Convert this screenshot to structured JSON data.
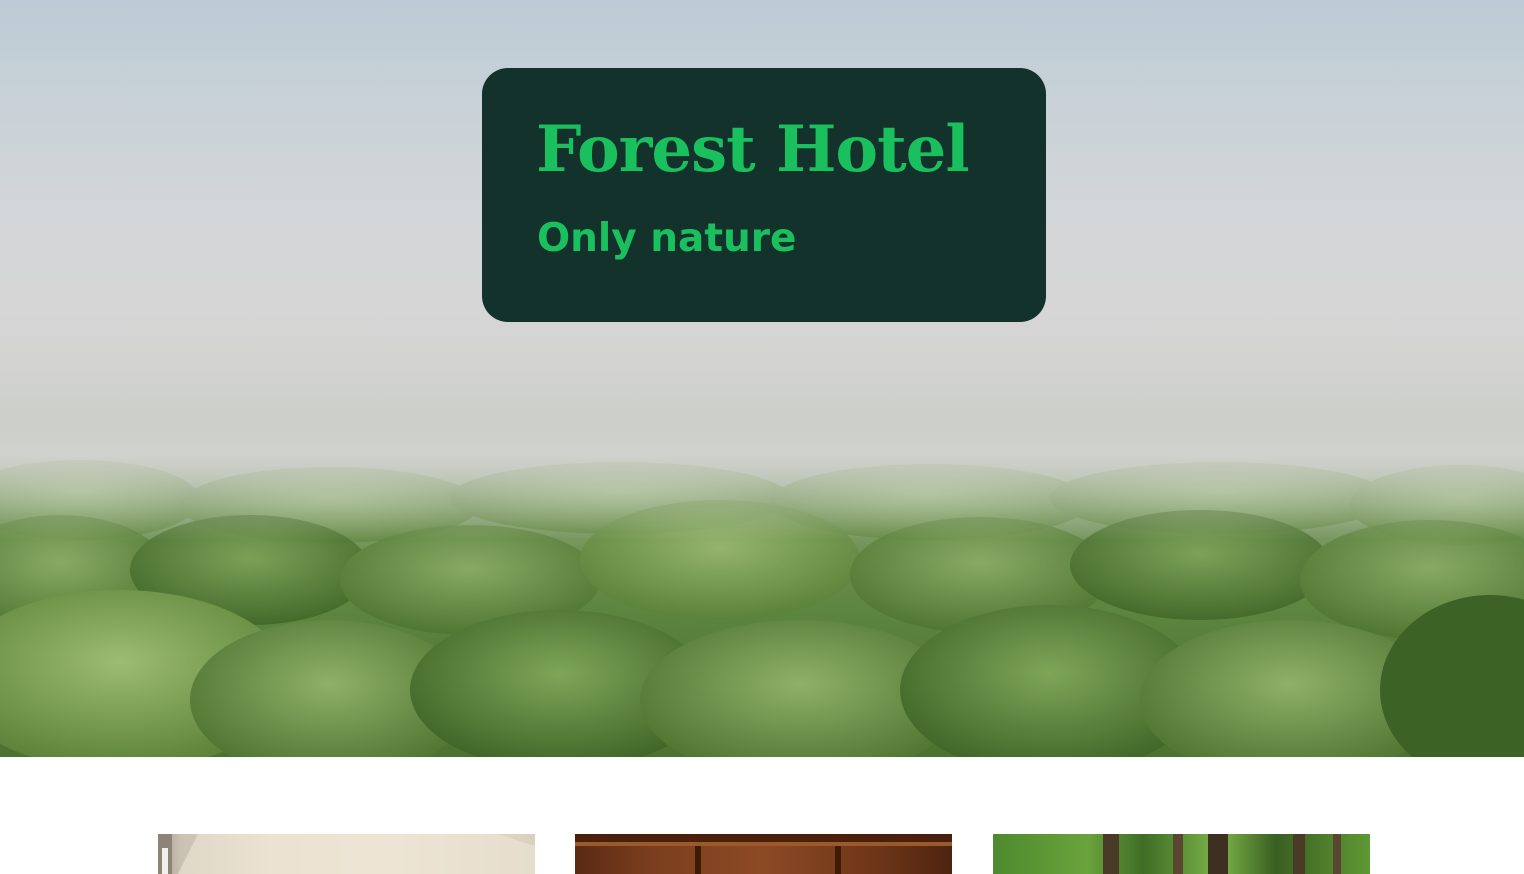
{
  "hero": {
    "image": "misty-forest-canopy",
    "title_card": {
      "title": "Forest Hotel",
      "subtitle": "Only nature",
      "background_color": "#12322b",
      "text_color": "#1abf5e"
    }
  },
  "gallery": {
    "items": [
      {
        "image": "bright-room-interior"
      },
      {
        "image": "wooden-cabin-interior"
      },
      {
        "image": "green-forest-trees"
      }
    ]
  }
}
